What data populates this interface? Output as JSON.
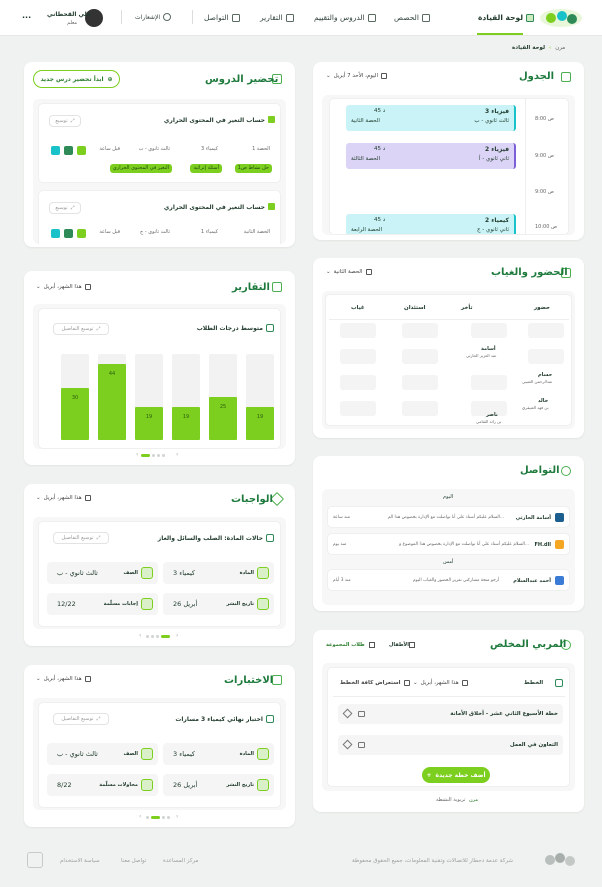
{
  "colors": {
    "accent": "#7ccf1e",
    "brand_dark": "#1e7a3c",
    "blue_slot": "#c9f3f7",
    "purple_slot": "#dcd4f7",
    "teal_icon": "#19c2c9"
  },
  "nav": {
    "dashboard": "لوحة القيادة",
    "classes": "الحصص",
    "lessons": "الدروس والتقييم",
    "reports": "التقارير",
    "communication": "التواصل",
    "notifications": "الإشعارات",
    "user_name": "علي القحطاني",
    "user_role": "معلم",
    "more": "..."
  },
  "breadcrumb": {
    "home": "مرن",
    "current": "لوحة القيادة"
  },
  "schedule": {
    "title": "الجدول",
    "date_filter": "اليوم، الأحد 7 أبريل",
    "times": [
      "8:00 ص",
      "9:00 ص",
      "9:00 ص",
      "10:00 ص"
    ],
    "slots": [
      {
        "subject": "فيزياء 3",
        "class": "ثالث ثانوي - ب",
        "duration": "45 د",
        "period": "الحصة الثانية"
      },
      {
        "subject": "فيزياء 2",
        "class": "ثاني ثانوي - أ",
        "duration": "45 د",
        "period": "الحصة الثالثة"
      },
      {
        "subject": "كيمياء 2",
        "class": "ثاني ثانوي - ج",
        "duration": "45 د",
        "period": "الحصة الرابعة"
      }
    ]
  },
  "attendance": {
    "title": "الحضور والغياب",
    "period_filter": "الحصة الثانية",
    "headers": [
      "حضور",
      "تأخر",
      "استئذان",
      "غياب"
    ],
    "students": [
      {
        "name": "أسامة",
        "sub": "عبد العزيز الحارثي"
      },
      {
        "name": "حسام",
        "sub": "عبدالرحمن العتيبي"
      },
      {
        "name": "خالد",
        "sub": "بن فهد العنيقري"
      },
      {
        "name": "ناصر",
        "sub": "بن رائد القثامي"
      }
    ]
  },
  "communication": {
    "title": "التواصل",
    "today": "اليوم",
    "yesterday": "أمس",
    "messages": [
      {
        "name": "أسامة الحارثي",
        "preview": "السلام عليكم أستاذ علي أنا تواصلت مع الإدارة بخصوص هذا الم...",
        "time": "منذ ساعة"
      },
      {
        "name": "FH.dll",
        "preview": "السلام عليكم أستاذ علي أنا تواصلت مع الإدارة بخصوص هذا الموضوع و...",
        "time": "منذ يوم"
      },
      {
        "name": "أحمد عبدالسلام",
        "preview": "أرجو منحة مشاركتي تقرير الحضور والغياب اليوم",
        "time": "منذ 3 أيام"
      }
    ]
  },
  "planner": {
    "title": "المربي المخلص",
    "tab_kids": "الأطفال",
    "tab_group": "طلاب المجموعة",
    "plans_label": "الخطط",
    "month_filter": "هذا الشهر، أبريل",
    "view_all": "استعراض كافة الخطط",
    "plans": [
      "خطة الأسبوع الثاني عشر - أخلاق الأمانة",
      "التعاون في العمل"
    ],
    "add_button": "أضف خطة جديدة",
    "footer_brand": "مرن",
    "footer_text": "تربوية النشطة"
  },
  "lesson_prep": {
    "title": "تحضير الدروس",
    "new_button": "ابدأ تحضير درس جديد",
    "items": [
      {
        "title": "حساب التغير في المحتوى الحراري",
        "expand": "توسيع",
        "period": "الحصة 1",
        "subject": "كيمياء 3",
        "class": "ثالث ثانوي - ب",
        "when": "قبل ساعة",
        "tags": [
          "حل نشاط ص1",
          "أسئلة إثرائية",
          "التغير في المحتوى الحراري"
        ]
      },
      {
        "title": "حساب التغير في المحتوى الحراري",
        "expand": "توسيع",
        "period": "الحصة الثانية",
        "subject": "كيمياء 1",
        "class": "ثالث ثانوي - ج",
        "when": "قبل ساعة"
      }
    ]
  },
  "reports": {
    "title": "التقارير",
    "month_filter": "هذا الشهر، أبريل",
    "chart_title": "متوسط درجات الطلاب",
    "expand": "توسيع التفاصيل"
  },
  "chart_data": {
    "type": "bar",
    "title": "متوسط درجات الطلاب",
    "categories": [
      "1",
      "2",
      "3",
      "4",
      "5",
      "6"
    ],
    "values": [
      30,
      44,
      19,
      19,
      25,
      19
    ],
    "ylim": [
      0,
      50
    ],
    "grid": false
  },
  "homework": {
    "title": "الواجبات",
    "month_filter": "هذا الشهر، أبريل",
    "item_title": "حالات المادة: الصلب والسائل والغاز",
    "expand": "توسيع التفاصيل",
    "subject_label": "المادة",
    "subject": "كيمياء 3",
    "class_label": "الصف",
    "class": "ثالث ثانوي - ب",
    "date_label": "تاريخ النشر",
    "date": "26 أبريل",
    "answers_label": "إجابات مسلّمة",
    "answers": "12/22"
  },
  "exams": {
    "title": "الاختبارات",
    "month_filter": "هذا الشهر، أبريل",
    "item_title": "اختبار نهائي كيمياء 3 مسارات",
    "expand": "توسيع التفاصيل",
    "subject_label": "المادة",
    "subject": "كيمياء 3",
    "class_label": "الصف",
    "class": "ثالث ثانوي - ب",
    "date_label": "تاريخ النشر",
    "date": "26 أبريل",
    "attempts_label": "محاولات مسلّمة",
    "attempts": "8/22"
  },
  "footer": {
    "copyright": "شركة عدمة دحطار للاتصالات وتقنية المعلومات، جميع الحقوق محفوظة",
    "help": "مركز المساعدة",
    "contact": "تواصل معنا",
    "privacy": "سياسة الاستخدام"
  }
}
